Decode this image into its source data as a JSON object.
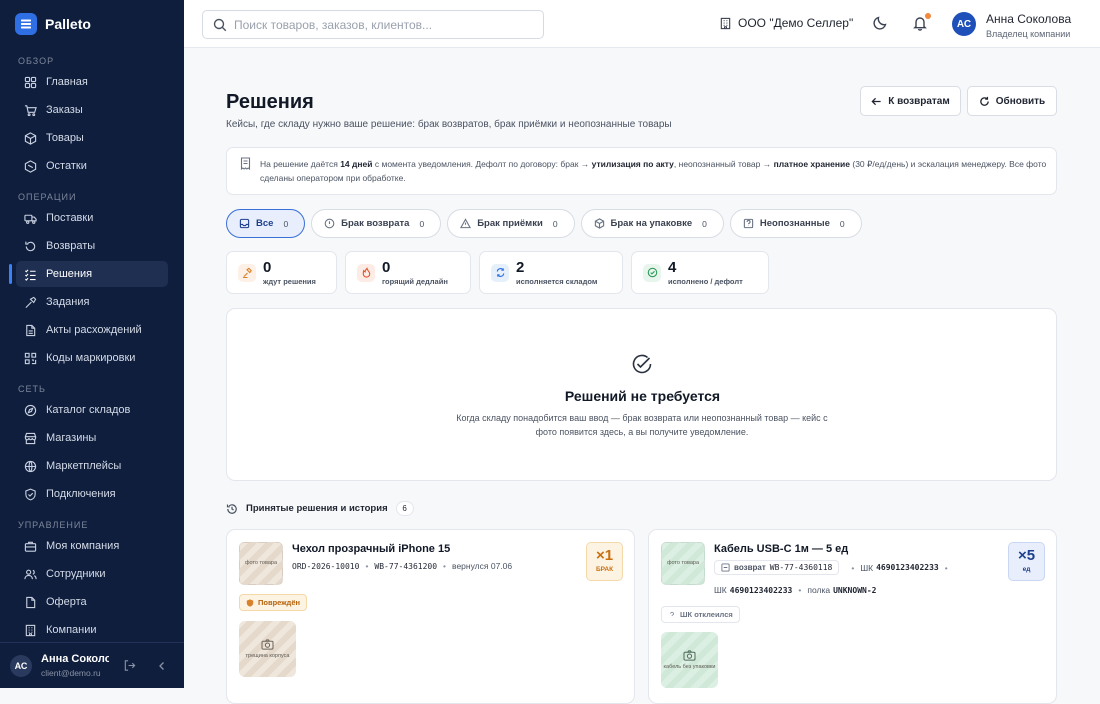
{
  "app": {
    "name": "Palleto"
  },
  "sidebar": {
    "sections": [
      {
        "title": "Обзор",
        "items": [
          {
            "label": "Главная",
            "icon": "grid-icon"
          },
          {
            "label": "Заказы",
            "icon": "cart-icon"
          },
          {
            "label": "Товары",
            "icon": "box-icon"
          },
          {
            "label": "Остатки",
            "icon": "stock-icon"
          }
        ]
      },
      {
        "title": "Операции",
        "items": [
          {
            "label": "Поставки",
            "icon": "truck-icon"
          },
          {
            "label": "Возвраты",
            "icon": "return-icon"
          },
          {
            "label": "Решения",
            "icon": "decisions-icon",
            "active": true
          },
          {
            "label": "Задания",
            "icon": "hammer-icon"
          },
          {
            "label": "Акты расхождений",
            "icon": "document-icon"
          },
          {
            "label": "Коды маркировки",
            "icon": "qr-icon"
          }
        ]
      },
      {
        "title": "Сеть",
        "items": [
          {
            "label": "Каталог складов",
            "icon": "compass-icon"
          },
          {
            "label": "Магазины",
            "icon": "store-icon"
          },
          {
            "label": "Маркетплейсы",
            "icon": "globe-icon"
          },
          {
            "label": "Подключения",
            "icon": "shield-icon"
          }
        ]
      },
      {
        "title": "Управление",
        "items": [
          {
            "label": "Моя компания",
            "icon": "briefcase-icon"
          },
          {
            "label": "Сотрудники",
            "icon": "users-icon"
          },
          {
            "label": "Оферта",
            "icon": "file-icon"
          },
          {
            "label": "Компании",
            "icon": "building-icon"
          }
        ]
      }
    ],
    "user": {
      "initials": "АС",
      "name": "Анна Соколова",
      "email": "client@demo.ru"
    }
  },
  "topbar": {
    "search_placeholder": "Поиск товаров, заказов, клиентов...",
    "org_name": "ООО \"Демо Селлер\"",
    "user": {
      "initials": "АС",
      "name": "Анна Соколова",
      "role": "Владелец компании"
    }
  },
  "page": {
    "title": "Решения",
    "subtitle": "Кейсы, где складу нужно ваше решение: брак возвратов, брак приёмки и неопознанные товары",
    "back_button": "К возвратам",
    "refresh_button": "Обновить",
    "notice": {
      "p1": "На решение даётся ",
      "b1": "14 дней",
      "p2": " с момента уведомления. Дефолт по договору: брак → ",
      "b2": "утилизация по акту",
      "p3": ", неопознанный товар → ",
      "b3": "платное хранение",
      "p4": " (30 ₽/ед/день) и эскалация менеджеру. Все фото сделаны оператором при обработке."
    }
  },
  "filters": [
    {
      "label": "Все",
      "count": "0",
      "icon": "inbox-icon",
      "active": true
    },
    {
      "label": "Брак возврата",
      "count": "0",
      "icon": "return-alert-icon"
    },
    {
      "label": "Брак приёмки",
      "count": "0",
      "icon": "warning-icon"
    },
    {
      "label": "Брак на упаковке",
      "count": "0",
      "icon": "package-icon"
    },
    {
      "label": "Неопознанные",
      "count": "0",
      "icon": "question-box-icon"
    }
  ],
  "stats": [
    {
      "value": "0",
      "label": "ждут решения",
      "icon": "gavel-icon",
      "color": "#fdf0e6"
    },
    {
      "value": "0",
      "label": "горящий дедлайн",
      "icon": "flame-icon",
      "color": "#fdebe6"
    },
    {
      "value": "2",
      "label": "исполняется складом",
      "icon": "refresh-icon",
      "color": "#e6f0fb"
    },
    {
      "value": "4",
      "label": "исполнено / дефолт",
      "icon": "check-circle-icon",
      "color": "#e8f5ec"
    }
  ],
  "empty_state": {
    "title": "Решений не требуется",
    "description": "Когда складу понадобится ваш ввод — брак возврата или неопознанный товар — кейс с фото появится здесь, а вы получите уведомление."
  },
  "history": {
    "title": "Принятые решения и история",
    "count": "6",
    "cards": [
      {
        "thumb": "фото товара",
        "title": "Чехол прозрачный iPhone 15",
        "order": "ORD-2026-10010",
        "wb": "WB-77-4361200",
        "returned": "вернулся 07.06",
        "qty": "×1",
        "qty_label": "брак",
        "tag": "Повреждён",
        "photo_caption": "трещина корпуса"
      },
      {
        "thumb": "фото товара",
        "title": "Кабель USB-C 1м — 5 ед",
        "return_label": "возврат",
        "wb": "WB-77-4360118",
        "sk_label": "ШК",
        "sk": "4690123402233",
        "shelf_label": "полка",
        "shelf": "UNKNOWN-2",
        "qty": "×5",
        "qty_label": "ед",
        "tag": "ШК отклеился",
        "photo_caption": "кабель без упаковки"
      }
    ]
  }
}
